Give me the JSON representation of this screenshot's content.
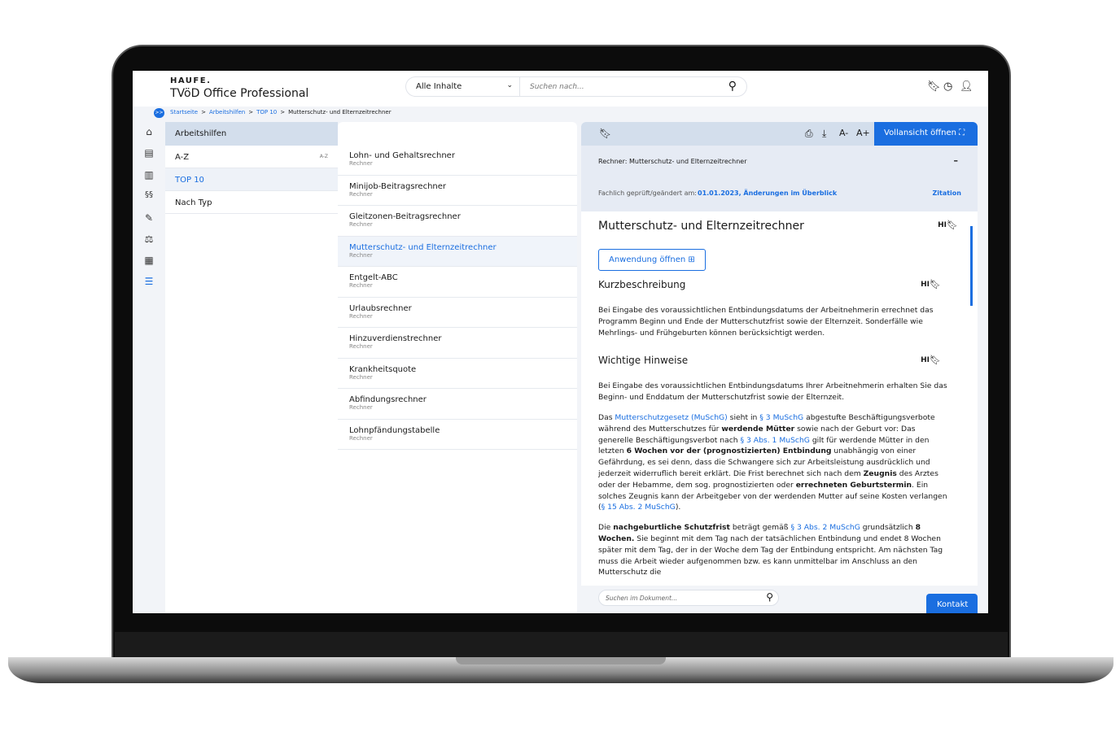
{
  "header": {
    "brand": "HAUFE.",
    "app_title": "TVöD Office Professional",
    "scope_select": "Alle Inhalte",
    "search_placeholder": "Suchen nach...",
    "icons": [
      "bookmark-icon",
      "history-icon",
      "user-icon"
    ]
  },
  "breadcrumb": [
    "Startseite",
    "Arbeitshilfen",
    "TOP 10",
    "Mutterschutz- und Elternzeitrechner"
  ],
  "sidebar_toggle": ">>",
  "sidebar_icons": [
    "home-icon",
    "newspaper-icon",
    "book-icon",
    "paragraph-icon",
    "edit-icon",
    "scales-icon",
    "document-icon",
    "list-icon"
  ],
  "left_panel": {
    "title": "Arbeitshilfen",
    "items": [
      {
        "label": "A-Z",
        "badge": "A-Z"
      },
      {
        "label": "TOP 10",
        "active": true
      },
      {
        "label": "Nach Typ"
      }
    ]
  },
  "list": [
    {
      "title": "Lohn- und Gehaltsrechner",
      "type": "Rechner"
    },
    {
      "title": "Minijob-Beitragsrechner",
      "type": "Rechner"
    },
    {
      "title": "Gleitzonen-Beitragsrechner",
      "type": "Rechner"
    },
    {
      "title": "Mutterschutz- und Elternzeitrechner",
      "type": "Rechner",
      "active": true
    },
    {
      "title": "Entgelt-ABC",
      "type": "Rechner"
    },
    {
      "title": "Urlaubsrechner",
      "type": "Rechner"
    },
    {
      "title": "Hinzuverdienstrechner",
      "type": "Rechner"
    },
    {
      "title": "Krankheitsquote",
      "type": "Rechner"
    },
    {
      "title": "Abfindungsrechner",
      "type": "Rechner"
    },
    {
      "title": "Lohnpfändungstabelle",
      "type": "Rechner"
    }
  ],
  "doc": {
    "toolbar": {
      "full_view": "Vollansicht öffnen",
      "font_smaller": "A-",
      "font_larger": "A+"
    },
    "info": {
      "prefix": "Rechner:",
      "name": "Mutterschutz- und Elternzeitrechner",
      "collapse": "–",
      "checked_label": "Fachlich geprüft/geändert am:",
      "checked_value": "01.01.2023, Änderungen im Überblick",
      "citation": "Zitation"
    },
    "title": "Mutterschutz- und Elternzeitrechner",
    "hi": "HI",
    "open_app": "Anwendung öffnen",
    "s1_title": "Kurzbeschreibung",
    "s1_text": "Bei Eingabe des voraussichtlichen Entbindungsdatums der Arbeitnehmerin errechnet das Programm Beginn und Ende der Mutterschutzfrist sowie der Elternzeit. Sonderfälle wie Mehrlings- und Frühgeburten können berücksichtigt werden.",
    "s2_title": "Wichtige Hinweise",
    "paragraphs": [
      [
        {
          "t": "Bei Eingabe des voraussichtlichen Entbindungsdatums Ihrer Arbeitnehmerin erhalten Sie das Beginn- und Enddatum der Mutterschutzfrist sowie der Elternzeit."
        }
      ],
      [
        {
          "t": "Das "
        },
        {
          "t": "Mutterschutzgesetz (MuSchG)",
          "k": "a"
        },
        {
          "t": " sieht in "
        },
        {
          "t": "§ 3 MuSchG",
          "k": "a"
        },
        {
          "t": " abgestufte Beschäftigungsverbote während des Mutterschutzes für "
        },
        {
          "t": "werdende Mütter",
          "k": "b"
        },
        {
          "t": " sowie nach der Geburt vor: Das generelle Beschäftigungsverbot nach "
        },
        {
          "t": "§ 3 Abs. 1 MuSchG",
          "k": "a"
        },
        {
          "t": " gilt für werdende Mütter in den letzten "
        },
        {
          "t": "6 Wochen vor der (prognostizierten) Entbindung",
          "k": "b"
        },
        {
          "t": " unabhängig von einer Gefährdung, es sei denn, dass die Schwangere sich zur Arbeitsleistung ausdrücklich und jederzeit widerruflich bereit erklärt. Die Frist berechnet sich nach dem "
        },
        {
          "t": "Zeugnis",
          "k": "b"
        },
        {
          "t": " des Arztes oder der Hebamme, dem sog. prognostizierten oder "
        },
        {
          "t": "errechneten Geburtstermin",
          "k": "b"
        },
        {
          "t": ". Ein solches Zeugnis kann der Arbeitgeber von der werdenden Mutter auf seine Kosten verlangen ("
        },
        {
          "t": "§ 15 Abs. 2 MuSchG",
          "k": "a"
        },
        {
          "t": ")."
        }
      ],
      [
        {
          "t": "Die "
        },
        {
          "t": "nachgeburtliche Schutzfrist",
          "k": "b"
        },
        {
          "t": " beträgt gemäß "
        },
        {
          "t": "§ 3 Abs. 2 MuSchG",
          "k": "a"
        },
        {
          "t": " grundsätzlich "
        },
        {
          "t": "8 Wochen.",
          "k": "b"
        },
        {
          "t": " Sie beginnt mit dem Tag nach der tatsächlichen Entbindung und endet 8 Wochen später mit dem Tag, der in der Woche dem Tag der Entbindung entspricht. Am nächsten Tag muss die Arbeit wieder aufgenommen bzw. es kann unmittelbar im Anschluss an den Mutterschutz die"
        }
      ]
    ],
    "doc_search_placeholder": "Suchen im Dokument...",
    "contact": "Kontakt"
  },
  "colors": {
    "accent": "#1a6ee0",
    "panel_header": "#d3deec",
    "info_bg": "#e6ebf4"
  }
}
